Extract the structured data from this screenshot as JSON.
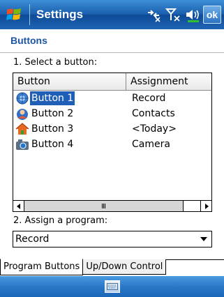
{
  "titlebar": {
    "title": "Settings",
    "ok_label": "ok"
  },
  "page": {
    "heading": "Buttons",
    "step1_label": "1. Select a button:",
    "step2_label": "2. Assign a program:"
  },
  "list": {
    "columns": [
      "Button",
      "Assignment"
    ],
    "rows": [
      {
        "button": "Button 1",
        "assignment": "Record",
        "icon": "record-mic-icon",
        "selected": true
      },
      {
        "button": "Button 2",
        "assignment": "Contacts",
        "icon": "contacts-icon",
        "selected": false
      },
      {
        "button": "Button 3",
        "assignment": "<Today>",
        "icon": "home-icon",
        "selected": false
      },
      {
        "button": "Button 4",
        "assignment": "Camera",
        "icon": "camera-icon",
        "selected": false
      }
    ],
    "scroll_grip": "III"
  },
  "program_combo": {
    "value": "Record"
  },
  "tabs": [
    {
      "label": "Program Buttons",
      "active": true
    },
    {
      "label": "Up/Down Control",
      "active": false
    }
  ],
  "colors": {
    "title_bar": "#1a5fae",
    "heading": "#1d55a5",
    "selection": "#1f5fb7"
  }
}
